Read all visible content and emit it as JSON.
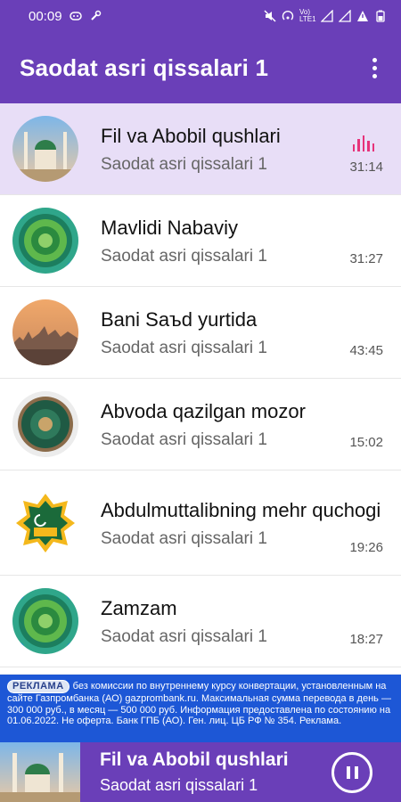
{
  "status_bar": {
    "time": "00:09",
    "network": "Vo) LTE1"
  },
  "app_bar": {
    "title": "Saodat asri qissalari 1"
  },
  "tracks": [
    {
      "title": "Fil va Abobil qushlari",
      "subtitle": "Saodat asri qissalari 1",
      "duration": "31:14",
      "active": true,
      "icon": "mosque-thumbnail"
    },
    {
      "title": "Mavlidi Nabaviy",
      "subtitle": "Saodat asri qissalari 1",
      "duration": "31:27",
      "active": false,
      "icon": "green-ornament-thumbnail"
    },
    {
      "title": "Bani Saъd yurtida",
      "subtitle": "Saodat asri qissalari 1",
      "duration": "43:45",
      "active": false,
      "icon": "sunset-city-thumbnail"
    },
    {
      "title": "Abvoda qazilgan mozor",
      "subtitle": "Saodat asri qissalari 1",
      "duration": "15:02",
      "active": false,
      "icon": "dark-green-ornament-thumbnail"
    },
    {
      "title": "Abdulmuttalibning mehr quchogi",
      "subtitle": "Saodat asri qissalari 1",
      "duration": "19:26",
      "active": false,
      "icon": "star-mosque-thumbnail"
    },
    {
      "title": "Zamzam",
      "subtitle": "Saodat asri qissalari 1",
      "duration": "18:27",
      "active": false,
      "icon": "green-ornament-thumbnail"
    }
  ],
  "ad": {
    "label": "РЕКЛАМА",
    "text": "без комиссии по внутреннему курсу конвертации, установленным на сайте Газпромбанка (АО) gazprombank.ru. Максимальная сумма перевода в день — 300 000 руб., в месяц — 500 000 руб. Информация предоставлена по состоянию на 01.06.2022. Не оферта. Банк ГПБ (АО). Ген. лиц. ЦБ РФ № 354. Реклама."
  },
  "player": {
    "title": "Fil va Abobil qushlari",
    "subtitle": "Saodat asri qissalari 1"
  },
  "colors": {
    "primary": "#6a3fb8",
    "active_row": "#e8def7",
    "equalizer": "#e6337a",
    "ad_background": "#1d57d6"
  }
}
